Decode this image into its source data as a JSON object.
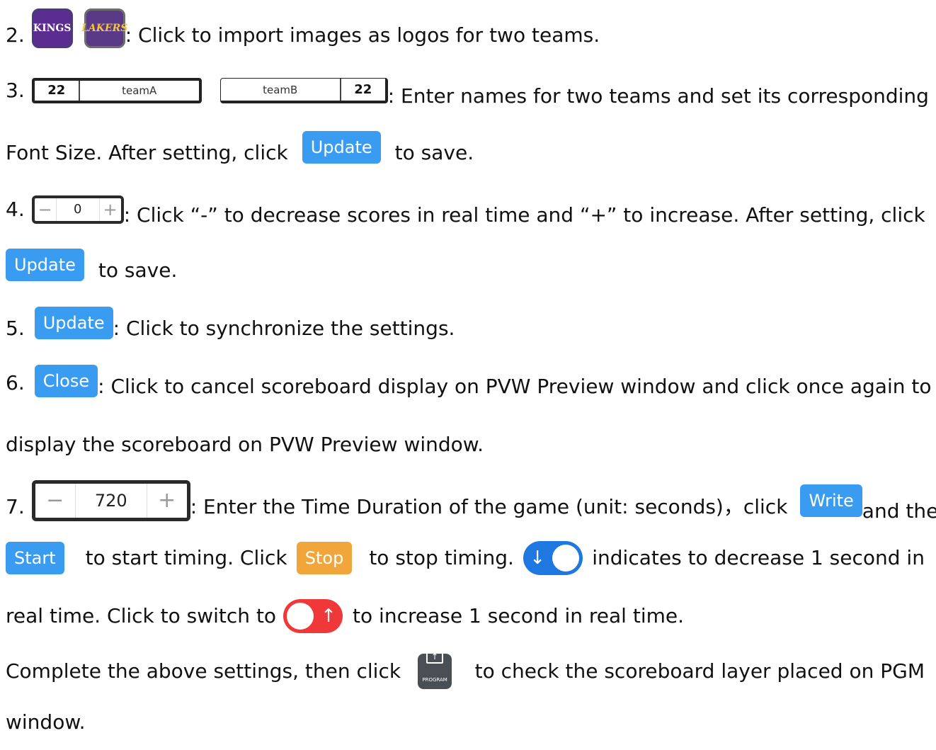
{
  "logos": {
    "kings": "KINGS",
    "lakers": "LAKERS"
  },
  "teamA": {
    "font_size": "22",
    "name": "teamA"
  },
  "teamB": {
    "font_size": "22",
    "name": "teamB"
  },
  "buttons": {
    "update": "Update",
    "close": "Close",
    "write": "Write",
    "start": "Start",
    "stop": "Stop"
  },
  "score_stepper": {
    "minus": "−",
    "value": "0",
    "plus": "+"
  },
  "time_stepper": {
    "minus": "−",
    "value": "720",
    "plus": "+"
  },
  "toggles": {
    "down_arrow": "↓",
    "up_arrow": "↑"
  },
  "program_icon": {
    "label": "PROGRAM",
    "arrow": "↑"
  },
  "items": {
    "i2": {
      "num": "2.",
      "text": ": Click to import images as logos for two teams."
    },
    "i3": {
      "num": "3.",
      "text_a": ": Enter names for two teams and set its corresponding",
      "text_b": "Font Size. After setting, click",
      "text_c": "to save."
    },
    "i4": {
      "num": "4.",
      "text_a": ": Click “-” to decrease scores in real time and “+” to increase. After setting, click",
      "text_b": "to save."
    },
    "i5": {
      "num": "5.",
      "text": ":  Click to synchronize the settings."
    },
    "i6": {
      "num": "6.",
      "text_a": ":  Click to cancel scoreboard display on PVW Preview window and click once again to",
      "text_b": "display the scoreboard on PVW Preview window."
    },
    "i7": {
      "num": "7.",
      "text_a": ": Enter the Time Duration of the game (unit: seconds)，click",
      "text_b": "and then",
      "text_c": "to start timing. Click",
      "text_d": "to stop timing.",
      "text_e": "indicates to decrease 1 second in",
      "text_f": "real time. Click to switch to",
      "text_g": "to increase 1 second in real time."
    },
    "final": {
      "text_a": "Complete the above settings, then click",
      "text_b": "to check the scoreboard layer placed on PGM",
      "text_c": "window."
    }
  }
}
